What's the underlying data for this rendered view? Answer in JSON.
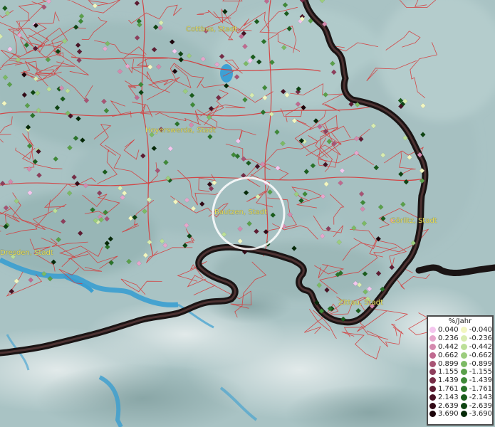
{
  "map": {
    "places": [
      {
        "name": "Cottbus, Stadt",
        "id": "cottbus"
      },
      {
        "name": "Hoyerswerda, Stadt",
        "id": "hoyerswerda"
      },
      {
        "name": "Bautzen, Stadt",
        "id": "bautzen"
      },
      {
        "name": "Görlitz, Stadt",
        "id": "goerlitz"
      },
      {
        "name": "Dresden, Stadt",
        "id": "dresden"
      },
      {
        "name": "Zittau, Stadt",
        "id": "zittau"
      }
    ]
  },
  "legend": {
    "title": "%/Jahr",
    "positive": [
      {
        "label": "0.040",
        "color": "#f4c6ee"
      },
      {
        "label": "0.236",
        "color": "#e6a6cc"
      },
      {
        "label": "0.442",
        "color": "#d48aae"
      },
      {
        "label": "0.662",
        "color": "#c06a90"
      },
      {
        "label": "0.899",
        "color": "#a85474"
      },
      {
        "label": "1.155",
        "color": "#8e3e5c"
      },
      {
        "label": "1.439",
        "color": "#762c46"
      },
      {
        "label": "1.761",
        "color": "#5e1c32"
      },
      {
        "label": "2.143",
        "color": "#481224"
      },
      {
        "label": "2.639",
        "color": "#320a16"
      },
      {
        "label": "3.690",
        "color": "#1c040a"
      }
    ],
    "negative": [
      {
        "label": "-0.040",
        "color": "#f2f6c0"
      },
      {
        "label": "-0.236",
        "color": "#d8ecb0"
      },
      {
        "label": "-0.442",
        "color": "#bcdf98"
      },
      {
        "label": "-0.662",
        "color": "#9ccd7e"
      },
      {
        "label": "-0.899",
        "color": "#7cba64"
      },
      {
        "label": "-1.155",
        "color": "#5aa04a"
      },
      {
        "label": "-1.439",
        "color": "#3f8a38"
      },
      {
        "label": "-1.761",
        "color": "#2a742a"
      },
      {
        "label": "-2.143",
        "color": "#1a5c1c"
      },
      {
        "label": "-2.639",
        "color": "#0e4412"
      },
      {
        "label": "-3.690",
        "color": "#062a08"
      }
    ]
  },
  "colors": {
    "terrain": "#a8c4c4",
    "borders": "#d83030",
    "state_border": "#1a1414",
    "selection_ring": "#ffffff"
  }
}
